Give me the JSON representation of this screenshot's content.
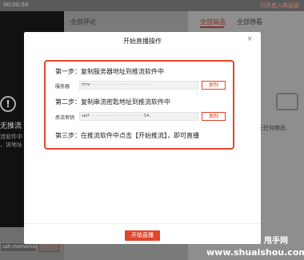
{
  "background": {
    "timer": "00:00:50",
    "top_right_text": "已开启入库运营",
    "left_panel": {
      "title": "无推流",
      "sub1": "流软件中",
      "sub2": "，该地址",
      "url_value": "ush.momomom...",
      "copy_label": "复制"
    },
    "comments_header": "全部评论",
    "tabs": [
      "全部商品",
      "全部想看"
    ],
    "empty_text": "无任何商品"
  },
  "watermark": {
    "line1": "甩手网",
    "line2": "www.shuaishou.com"
  },
  "modal": {
    "title": "开始直播操作",
    "close_glyph": "×",
    "step1": "第一步：复制服务器地址到推流软件中",
    "server_label": "服务器",
    "server_value": "rtmr · · · · · · · · · · · · · · · · · · · · · · ·",
    "step2": "第二步：复制串流密匙地址到推流软件中",
    "key_label": "串流密钥",
    "key_value": "sprf · · · · · · · · · · · · · · · · · · · · · 54...",
    "copy_label": "复制",
    "step3": "第三步：在推流软件中点击【开始推流】，即可直播",
    "start_button": "开始直播"
  },
  "colors": {
    "accent": "#e0462c",
    "overlay": "#8a8a8a"
  }
}
